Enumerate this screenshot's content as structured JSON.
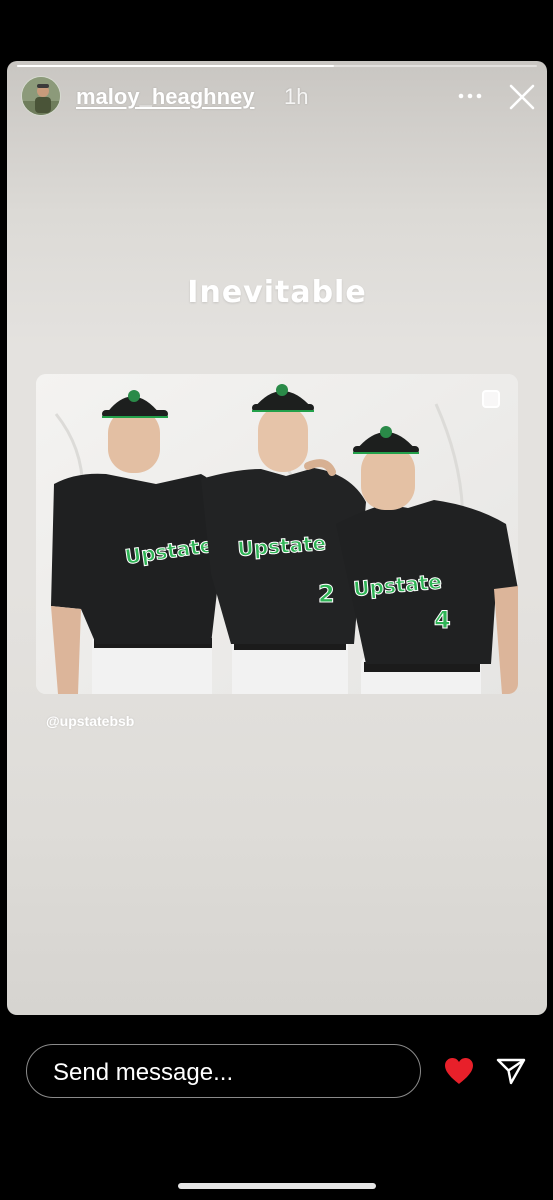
{
  "story": {
    "progress": 0.61,
    "user": {
      "username": "maloy_heaghney",
      "timestamp": "1h",
      "avatar": "avatar-photo"
    },
    "caption": "Inevitable",
    "photo": {
      "description_icon": "team-photo",
      "jersey_text": "Upstate",
      "jersey_numbers": [
        "2",
        "4"
      ]
    },
    "credit": "@upstatebsb"
  },
  "footer": {
    "message_placeholder": "Send message...",
    "heart_color": "#e8202a"
  },
  "icons": {
    "more": "more-icon",
    "close": "close-icon",
    "heart": "heart-icon",
    "send": "send-icon"
  }
}
